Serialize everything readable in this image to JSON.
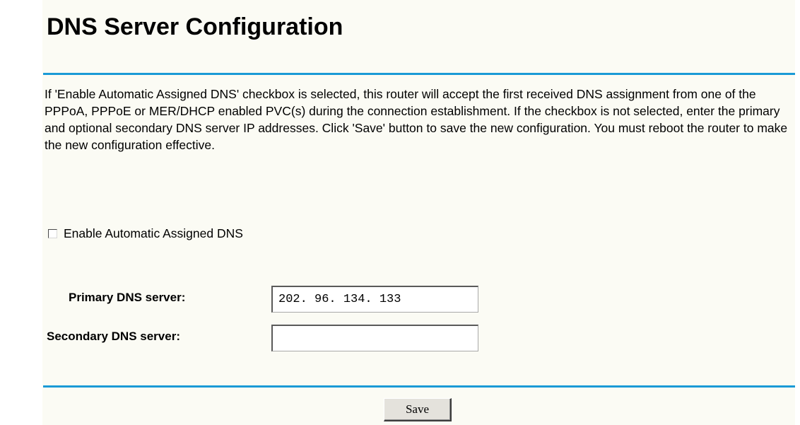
{
  "page": {
    "title": "DNS Server Configuration",
    "description": "If 'Enable Automatic Assigned DNS' checkbox is selected, this router will accept the first received DNS assignment from one of the PPPoA, PPPoE or MER/DHCP enabled PVC(s) during the connection establishment. If the checkbox is not selected, enter the primary and optional secondary DNS server IP addresses. Click 'Save' button to save the new configuration. You must reboot the router to make the new configuration effective."
  },
  "auto_dns": {
    "label": "Enable Automatic Assigned DNS",
    "checked": false
  },
  "primary_dns": {
    "label": "Primary DNS server:",
    "value": "202. 96. 134. 133"
  },
  "secondary_dns": {
    "label": "Secondary DNS server:",
    "value": ""
  },
  "actions": {
    "save_label": "Save"
  },
  "colors": {
    "accent_rule": "#1a9ad6",
    "panel_background": "#fbfbf4"
  }
}
